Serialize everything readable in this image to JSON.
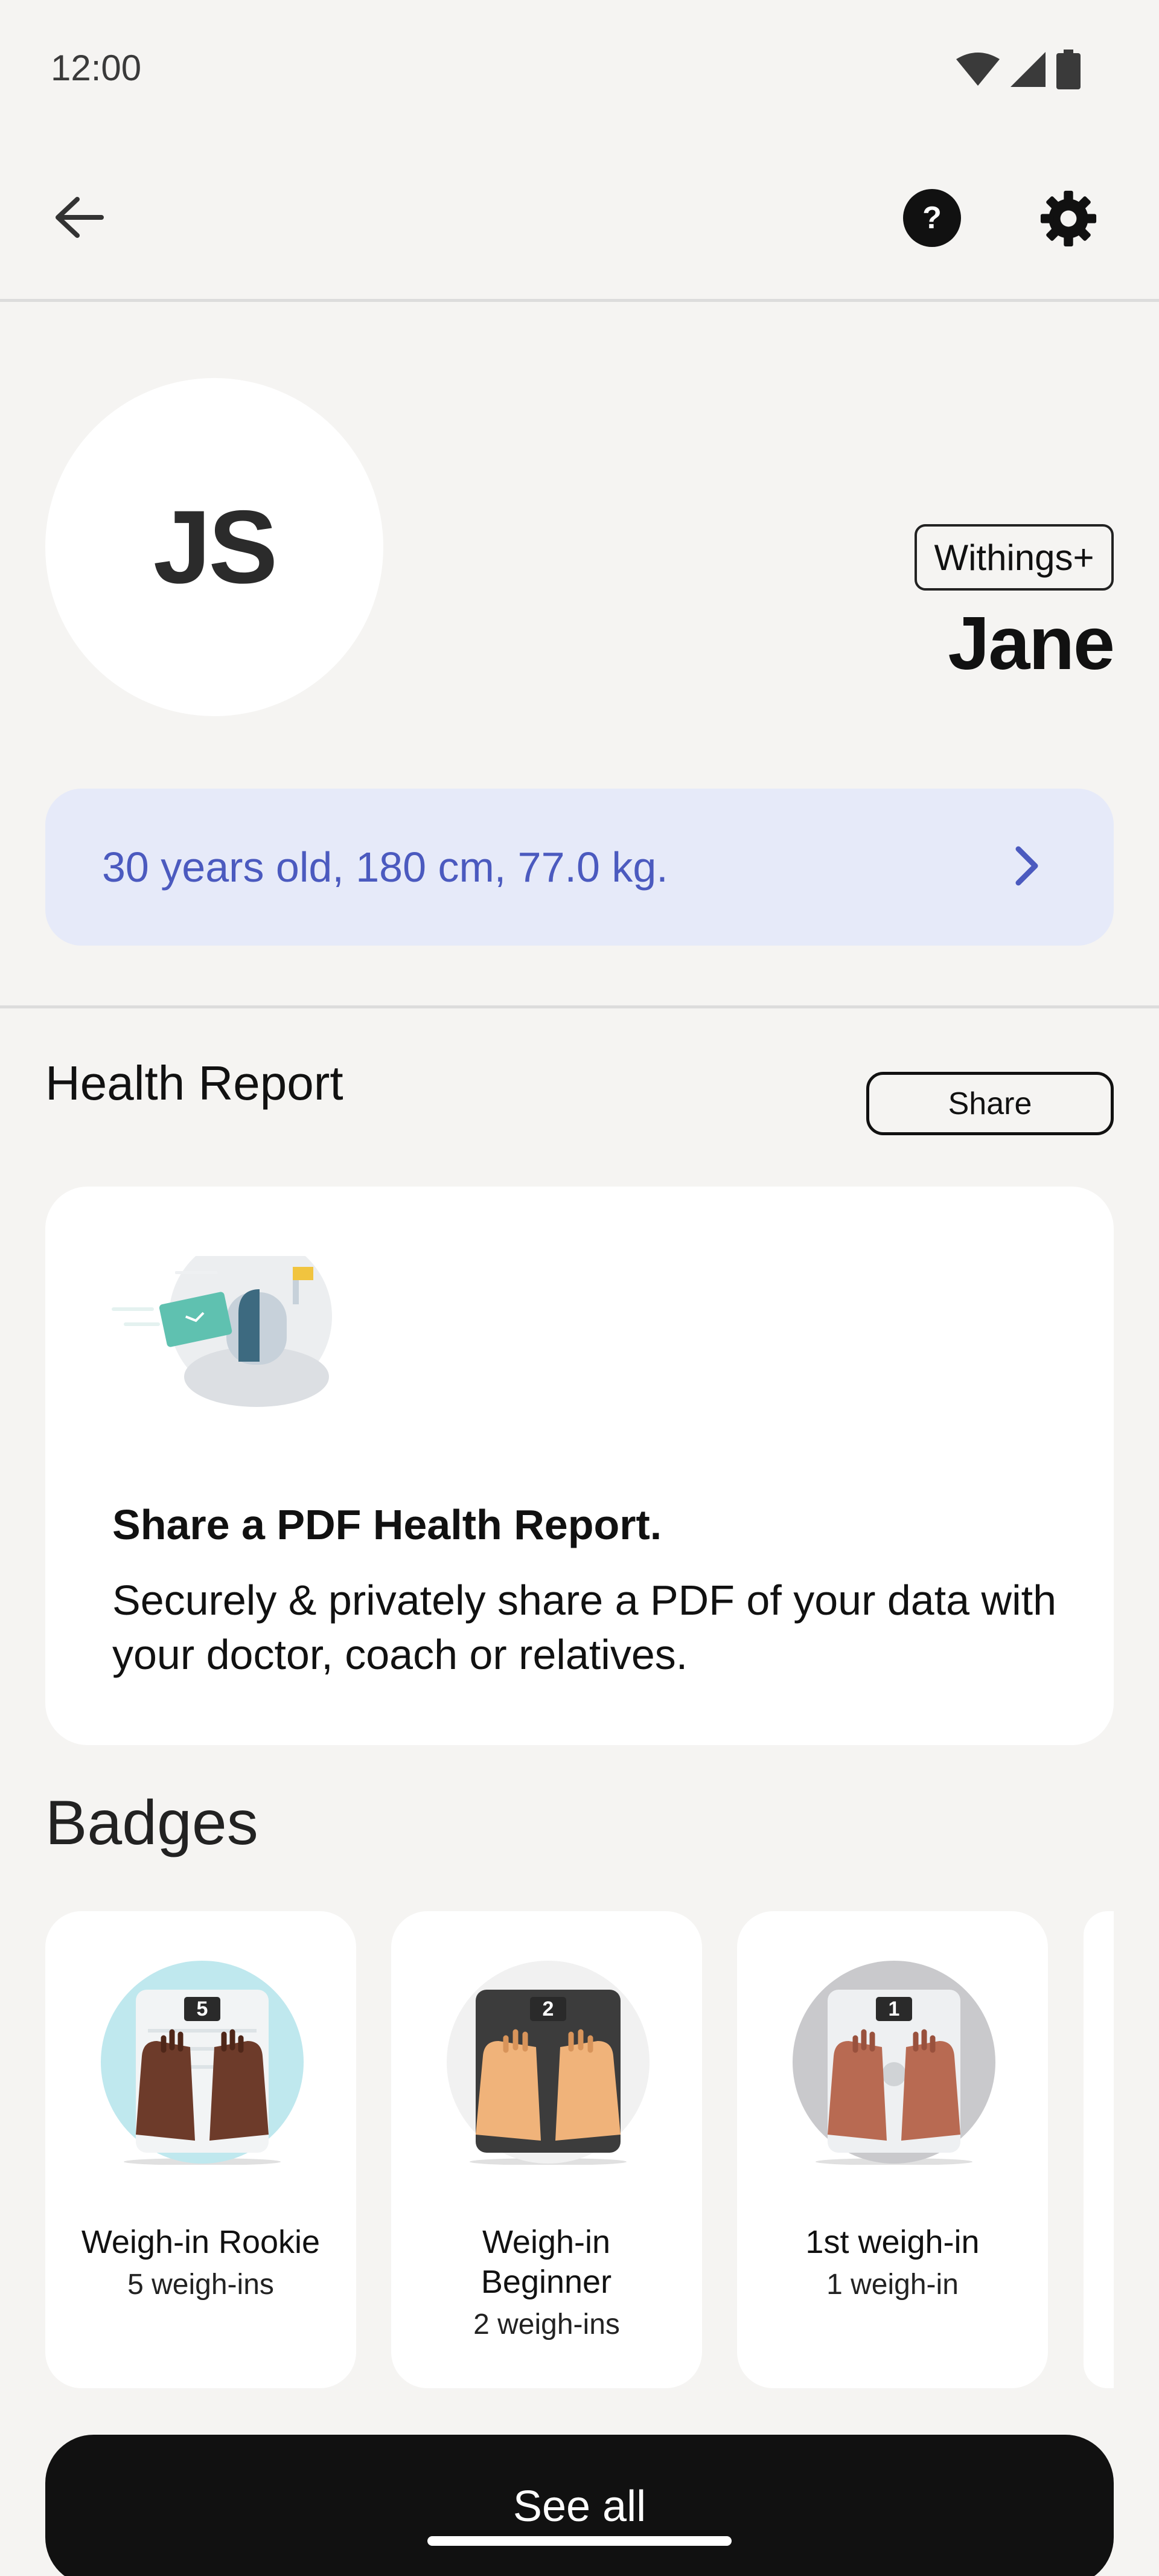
{
  "status_bar": {
    "time": "12:00",
    "icons": [
      "wifi-icon",
      "signal-icon",
      "battery-icon"
    ]
  },
  "app_bar": {
    "icons": [
      "back-arrow-icon",
      "help-icon",
      "gear-icon"
    ],
    "help_symbol": "?"
  },
  "profile": {
    "initials": "JS",
    "plan_badge": "Withings+",
    "name": "Jane",
    "summary": "30 years old, 180 cm, 77.0 kg."
  },
  "health_report": {
    "title": "Health Report",
    "share_label": "Share",
    "card_title": "Share a PDF Health Report.",
    "card_description": "Securely & privately share a PDF of your data with your doctor, coach or relatives."
  },
  "badges": {
    "title": "Badges",
    "items": [
      {
        "name": "Weigh-in Rookie",
        "count": "5 weigh-ins",
        "number": "5"
      },
      {
        "name": "Weigh-in Beginner",
        "count": "2 weigh-ins",
        "number": "2"
      },
      {
        "name": "1st weigh-in",
        "count": "1 weigh-in",
        "number": "1"
      }
    ],
    "see_all_label": "See all"
  },
  "colors": {
    "background": "#f5f4f2",
    "summary_bg": "#e6eaf9",
    "summary_text": "#4b5abf",
    "card_bg": "#ffffff",
    "primary_button": "#111111"
  }
}
